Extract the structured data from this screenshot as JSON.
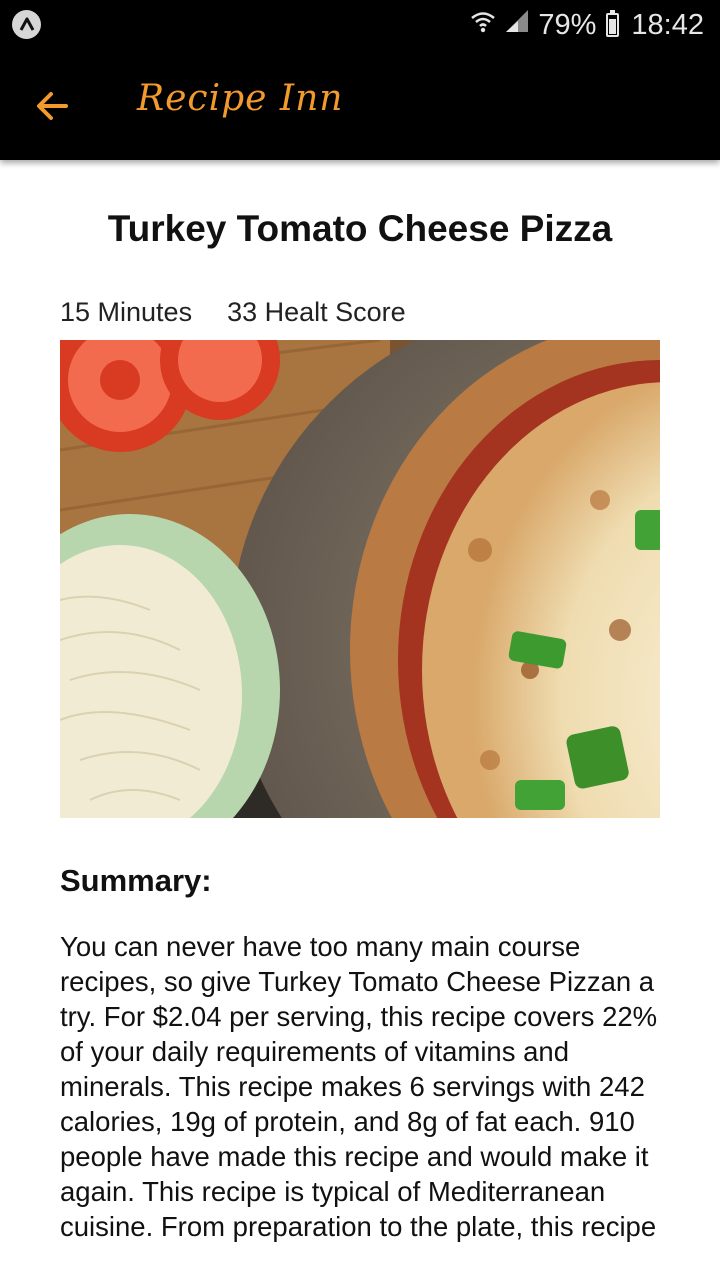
{
  "status_bar": {
    "battery": "79%",
    "time": "18:42"
  },
  "app_bar": {
    "title": "Recipe Inn",
    "back_icon": "arrow-left-icon",
    "accent_color": "#f39a2e"
  },
  "recipe": {
    "title": "Turkey Tomato Cheese Pizza",
    "ready_time": "15 Minutes",
    "health_score": "33 Healt Score",
    "image_alt": "pizza-photo",
    "summary_heading": "Summary:",
    "summary_text": "You can never have too many main course recipes, so give Turkey Tomato Cheese Pizzan a try. For $2.04 per serving, this recipe covers 22% of your daily requirements of vitamins and minerals. This recipe makes 6 servings with 242 calories, 19g of protein, and 8g of fat each. 910 people have made this recipe and would make it again. This recipe is typical of Mediterranean cuisine. From preparation to the plate, this recipe"
  }
}
